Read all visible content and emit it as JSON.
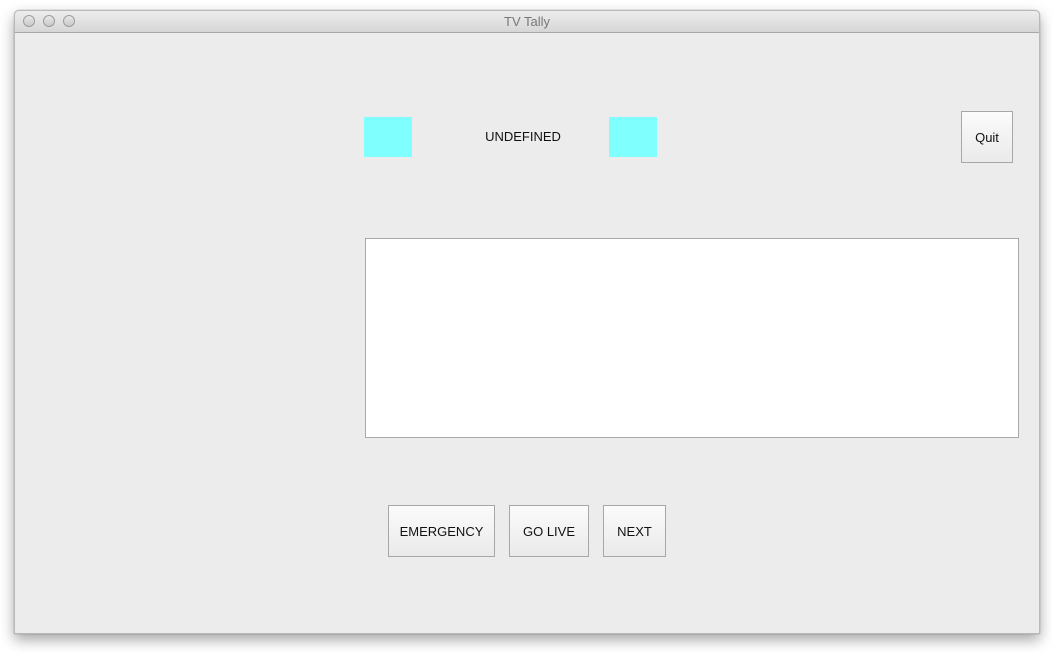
{
  "window": {
    "title": "TV Tally"
  },
  "tally": {
    "status_text": "UNDEFINED",
    "indicator_color": "#80ffff"
  },
  "buttons": {
    "quit": "Quit",
    "emergency": "EMERGENCY",
    "go_live": "GO LIVE",
    "next": "NEXT"
  },
  "message_area": {
    "value": ""
  }
}
